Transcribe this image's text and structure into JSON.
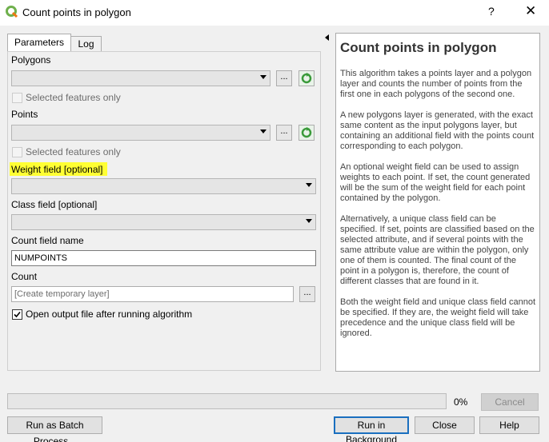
{
  "window": {
    "title": "Count points in polygon",
    "help_glyph": "?",
    "close_glyph": "✕"
  },
  "tabs": [
    {
      "label": "Parameters"
    },
    {
      "label": "Log"
    }
  ],
  "params": {
    "polygons": {
      "label": "Polygons",
      "value": "",
      "selected_only": "Selected features only"
    },
    "points": {
      "label": "Points",
      "value": "",
      "selected_only": "Selected features only"
    },
    "weight_field": {
      "label": "Weight field [optional]",
      "highlight_color": "#ffff33"
    },
    "class_field": {
      "label": "Class field [optional]"
    },
    "count_field": {
      "label": "Count field name",
      "value": "NUMPOINTS"
    },
    "count": {
      "label": "Count",
      "placeholder": "[Create temporary layer]"
    },
    "open_output": {
      "label": "Open output file after running algorithm",
      "checked": true
    },
    "ellipsis": "..."
  },
  "help": {
    "heading": "Count points in polygon",
    "paragraphs": [
      "This algorithm takes a points layer and a polygon layer and counts the number of points from the first one in each polygons of the second one.",
      "A new polygons layer is generated, with the exact same content as the input polygons layer, but containing an additional field with the points count corresponding to each polygon.",
      "An optional weight field can be used to assign weights to each point. If set, the count generated will be the sum of the weight field for each point contained by the polygon.",
      "Alternatively, a unique class field can be specified. If set, points are classified based on the selected attribute, and if several points with the same attribute value are within the polygon, only one of them is counted. The final count of the point in a polygon is, therefore, the count of different classes that are found in it.",
      "Both the weight field and unique class field cannot be specified. If they are, the weight field will take precedence and the unique class field will be ignored."
    ]
  },
  "progress": {
    "percent_label": "0%",
    "value": 0
  },
  "buttons": {
    "cancel": "Cancel",
    "batch": "Run as Batch Process...",
    "background": "Run in Background",
    "close": "Close",
    "help": "Help"
  },
  "colors": {
    "accent": "#1a6fbf",
    "progress": "#06b025",
    "qgis_green": "#6fb04c"
  }
}
